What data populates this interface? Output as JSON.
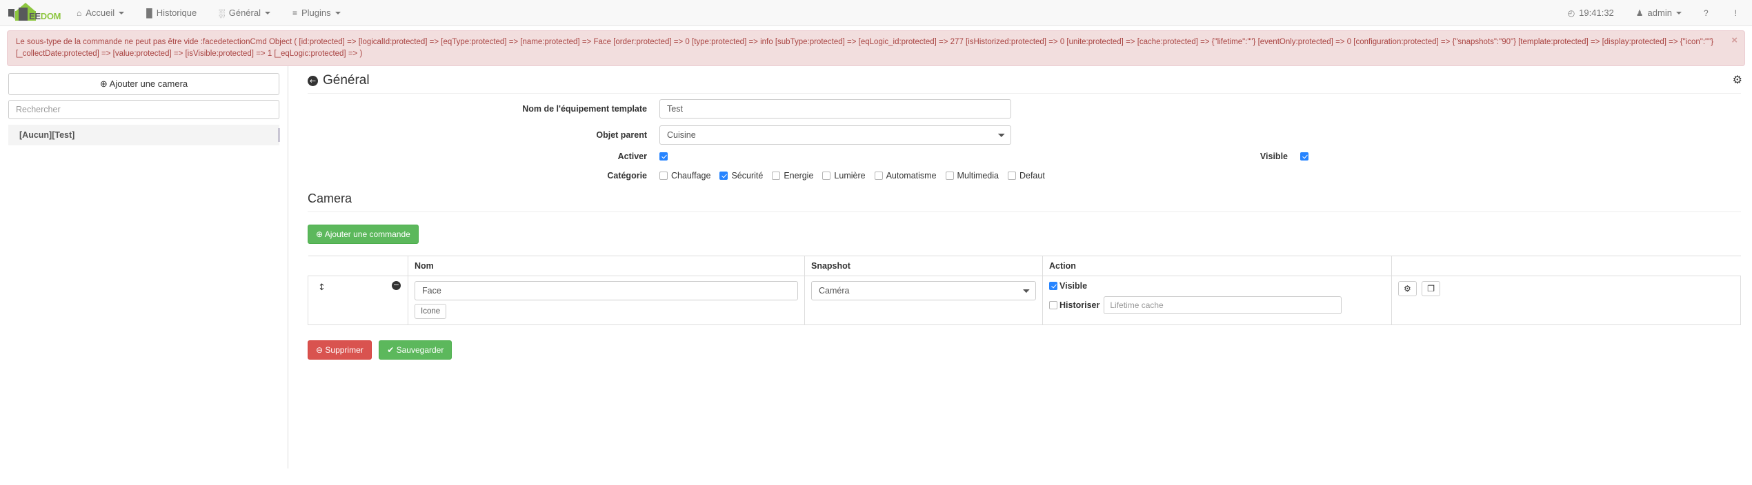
{
  "navbar": {
    "brand": {
      "gray": "EE",
      "green": "DOM"
    },
    "items": [
      {
        "label": "Accueil",
        "icon": "home-icon",
        "glyph": "⌂",
        "caret": true
      },
      {
        "label": "Historique",
        "icon": "chart-bar-icon",
        "glyph": "█",
        "caret": false
      },
      {
        "label": "Général",
        "icon": "grid-icon",
        "glyph": "░",
        "caret": true
      },
      {
        "label": "Plugins",
        "icon": "list-icon",
        "glyph": "≡",
        "caret": true
      }
    ],
    "right": {
      "clock_glyph": "◴",
      "time": "19:41:32",
      "user_glyph": "♟",
      "user": "admin",
      "help_glyph": "?",
      "info_glyph": "!"
    }
  },
  "alert": {
    "message": "Le sous-type de la commande ne peut pas être vide :facedetectionCmd Object ( [id:protected] => [logicalId:protected] => [eqType:protected] => [name:protected] => Face [order:protected] => 0 [type:protected] => info [subType:protected] => [eqLogic_id:protected] => 277 [isHistorized:protected] => 0 [unite:protected] => [cache:protected] => {\"lifetime\":\"\"} [eventOnly:protected] => 0 [configuration:protected] => {\"snapshots\":\"90\"} [template:protected] => [display:protected] => {\"icon\":\"\"} [_collectDate:protected] => [value:protected] => [isVisible:protected] => 1 [_eqLogic:protected] => )",
    "close_label": "×"
  },
  "sidebar": {
    "add_button": "Ajouter une camera",
    "add_button_glyph": "⊕",
    "search_placeholder": "Rechercher",
    "search_value": "",
    "items": [
      {
        "label": "[Aucun][Test]",
        "selected": true
      }
    ]
  },
  "page": {
    "back_glyph": "←",
    "title": "Général",
    "gear_glyph": "⚙"
  },
  "form": {
    "name_label": "Nom de l'équipement template",
    "name_value": "Test",
    "parent_label": "Objet parent",
    "parent_value": "Cuisine",
    "parent_options": [
      "Cuisine"
    ],
    "activer_label": "Activer",
    "activer_checked": true,
    "visible_label": "Visible",
    "visible_checked": true,
    "categorie_label": "Catégorie",
    "categories": [
      {
        "label": "Chauffage",
        "checked": false
      },
      {
        "label": "Sécurité",
        "checked": true
      },
      {
        "label": "Energie",
        "checked": false
      },
      {
        "label": "Lumière",
        "checked": false
      },
      {
        "label": "Automatisme",
        "checked": false
      },
      {
        "label": "Multimedia",
        "checked": false
      },
      {
        "label": "Defaut",
        "checked": false
      }
    ]
  },
  "commands": {
    "section_title": "Camera",
    "add_command_label": "Ajouter une commande",
    "add_command_glyph": "⊕",
    "headers": {
      "handle": "",
      "nom": "Nom",
      "snapshot": "Snapshot",
      "action": "Action",
      "tools": ""
    },
    "rows": [
      {
        "handle_glyph": "↕",
        "remove_glyph": "−",
        "name_value": "Face",
        "icone_label": "Icone",
        "snapshot_value": "Caméra",
        "snapshot_options": [
          "Caméra"
        ],
        "visible_label": "Visible",
        "visible_checked": true,
        "historiser_label": "Historiser",
        "historiser_checked": false,
        "lifetime_placeholder": "Lifetime cache",
        "lifetime_value": "",
        "config_glyph": "⚙",
        "copy_glyph": "❐"
      }
    ]
  },
  "footer": {
    "delete_label": "Supprimer",
    "delete_glyph": "⊖",
    "save_label": "Sauvegarder",
    "save_glyph": "✔"
  },
  "colors": {
    "brand_green": "#8dc63f",
    "alert_bg": "#f2dede",
    "alert_text": "#a94442",
    "accent_blue": "#2684ff",
    "success": "#5cb85c",
    "danger": "#d9534f"
  }
}
